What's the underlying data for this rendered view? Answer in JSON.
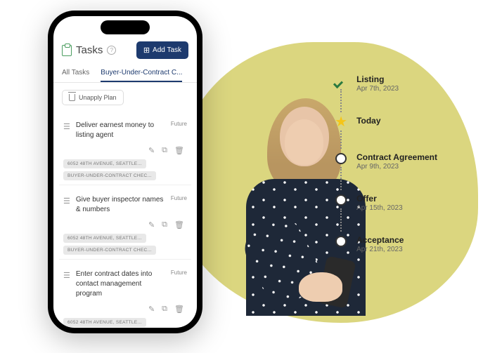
{
  "header": {
    "title": "Tasks",
    "addButton": "Add Task"
  },
  "tabs": {
    "all": "All Tasks",
    "active": "Buyer-Under-Contract C..."
  },
  "unapplyLabel": "Unapply Plan",
  "tasks": [
    {
      "title": "Deliver earnest money to listing agent",
      "status": "Future",
      "tags": [
        "6052 48TH AVENUE, SEATTLE...",
        "BUYER-UNDER-CONTRACT CHEC..."
      ]
    },
    {
      "title": "Give buyer inspector names & numbers",
      "status": "Future",
      "tags": [
        "6052 48TH AVENUE, SEATTLE...",
        "BUYER-UNDER-CONTRACT CHEC..."
      ]
    },
    {
      "title": "Enter contract dates into contact management program",
      "status": "Future",
      "tags": [
        "6052 48TH AVENUE, SEATTLE..."
      ]
    }
  ],
  "timeline": [
    {
      "icon": "check",
      "label": "Listing",
      "date": "Apr 7th, 2023"
    },
    {
      "icon": "star",
      "label": "Today",
      "date": ""
    },
    {
      "icon": "circle",
      "label": "Contract Agreement",
      "date": "Apr 9th, 2023"
    },
    {
      "icon": "circle",
      "label": "Offer",
      "date": "Apr 15th, 2023"
    },
    {
      "icon": "circle",
      "label": "Acceptance",
      "date": "Apr 21th, 2023"
    }
  ]
}
